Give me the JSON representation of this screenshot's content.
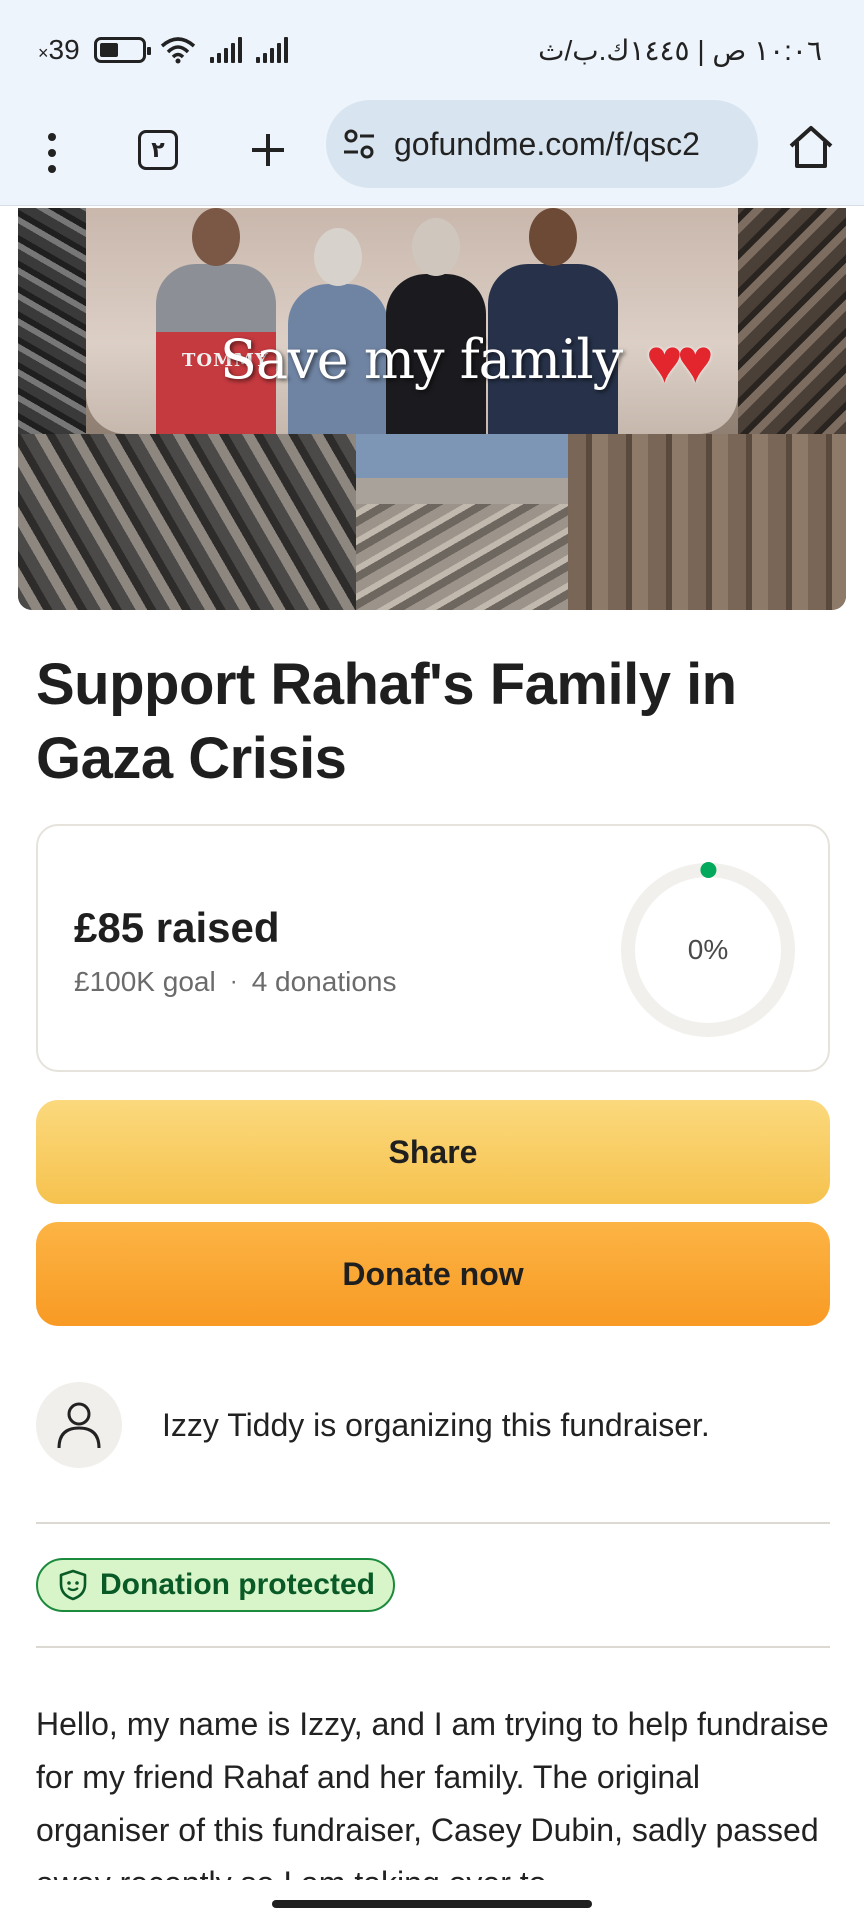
{
  "status_bar": {
    "battery": "39",
    "time": "١٠:٠٦ ص | ١٤٤٥ك.ب/ث"
  },
  "browser": {
    "tab_count": "٢",
    "url": "gofundme.com/f/qsc2"
  },
  "hero": {
    "caption": "Save my family",
    "shirt_text": "TOMMY"
  },
  "campaign": {
    "title": "Support Rahaf's Family in Gaza Crisis",
    "raised": "£85 raised",
    "goal": "£100K goal",
    "separator": "·",
    "donations": "4 donations",
    "percent_label": "0%",
    "percent_value": 0.085
  },
  "actions": {
    "share_label": "Share",
    "donate_label": "Donate now"
  },
  "organizer": {
    "text": "Izzy Tiddy is organizing this fundraiser."
  },
  "protection": {
    "label": "Donation protected"
  },
  "story": {
    "text": "Hello, my name is Izzy, and I am trying to help fundraise for my friend Rahaf and her family. The original organiser of this fundraiser, Casey Dubin, sadly passed away recently so I am taking over to"
  },
  "colors": {
    "accent_green": "#02a95c",
    "badge_bg": "#d7f5c9",
    "share_yellow": "#f6c24e",
    "donate_orange": "#f89a24",
    "chrome_bg": "#eef4fb"
  },
  "icons": {
    "menu": "kebab-icon",
    "new_tab": "plus-icon",
    "site_settings": "tune-icon",
    "home": "home-icon",
    "organizer": "user-icon",
    "protection": "shield-icon"
  }
}
